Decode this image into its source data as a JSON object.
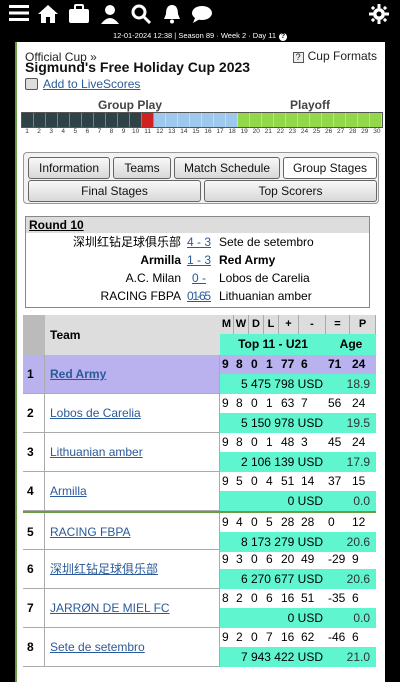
{
  "status": {
    "text": "12-01-2024 12:38 | Season 89 · Week 2 · Day 11",
    "help": "?"
  },
  "header": {
    "breadcrumb": "Official Cup »",
    "title": "Sigmund's Free Holiday Cup 2023",
    "cup_formats": "Cup Formats",
    "livescores": "Add to LiveScores"
  },
  "progress": {
    "group_label": "Group Play",
    "playoff_label": "Playoff",
    "days": [
      "1",
      "2",
      "3",
      "4",
      "5",
      "6",
      "7",
      "8",
      "9",
      "10",
      "11",
      "12",
      "13",
      "14",
      "15",
      "16",
      "17",
      "18",
      "19",
      "20",
      "21",
      "22",
      "23",
      "24",
      "25",
      "26",
      "27",
      "28",
      "29",
      "30"
    ],
    "current_day": 11,
    "colors": {
      "played": "#2f4248",
      "current": "#d02020",
      "group": "#9ec8ec",
      "playoff": "#92d84a"
    }
  },
  "tabs": {
    "information": "Information",
    "teams": "Teams",
    "schedule": "Match Schedule",
    "group_stages": "Group Stages",
    "final_stages": "Final Stages",
    "top_scorers": "Top Scorers"
  },
  "round": {
    "title": "Round 10",
    "matches": [
      {
        "home": "深圳红钻足球俱乐部",
        "score": "4 - 3",
        "away": "Sete de setembro",
        "bold": false
      },
      {
        "home": "Armilla",
        "score": "1 - 3",
        "away": "Red Army",
        "bold": true
      },
      {
        "home": "A.C. Milan",
        "score": "0 - 16",
        "away": "Lobos de Carelia",
        "bold": false
      },
      {
        "home": "RACING FBPA",
        "score": "0 - 5",
        "away": "Lithuanian amber",
        "bold": false
      }
    ]
  },
  "standings": {
    "col_team": "Team",
    "cols": [
      "M",
      "W",
      "D",
      "L",
      "+",
      "-",
      "=",
      "P"
    ],
    "sub_top": "Top 11 - U21",
    "sub_age": "Age",
    "rows": [
      {
        "pos": "1",
        "team": "Red Army",
        "m": "9",
        "w": "8",
        "d": "0",
        "l": "1",
        "gf": "77",
        "ga": "6",
        "diff": "71",
        "p": "24",
        "value": "5 475 798 USD",
        "age": "18.9"
      },
      {
        "pos": "2",
        "team": "Lobos de Carelia",
        "m": "9",
        "w": "8",
        "d": "0",
        "l": "1",
        "gf": "63",
        "ga": "7",
        "diff": "56",
        "p": "24",
        "value": "5 150 978 USD",
        "age": "19.5"
      },
      {
        "pos": "3",
        "team": "Lithuanian amber",
        "m": "9",
        "w": "8",
        "d": "0",
        "l": "1",
        "gf": "48",
        "ga": "3",
        "diff": "45",
        "p": "24",
        "value": "2 106 139 USD",
        "age": "17.9"
      },
      {
        "pos": "4",
        "team": "Armilla",
        "m": "9",
        "w": "5",
        "d": "0",
        "l": "4",
        "gf": "51",
        "ga": "14",
        "diff": "37",
        "p": "15",
        "value": "0 USD",
        "age": "0.0"
      },
      {
        "pos": "5",
        "team": "RACING FBPA",
        "m": "9",
        "w": "4",
        "d": "0",
        "l": "5",
        "gf": "28",
        "ga": "28",
        "diff": "0",
        "p": "12",
        "value": "8 173 279 USD",
        "age": "20.6"
      },
      {
        "pos": "6",
        "team": "深圳红钻足球俱乐部",
        "m": "9",
        "w": "3",
        "d": "0",
        "l": "6",
        "gf": "20",
        "ga": "49",
        "diff": "-29",
        "p": "9",
        "value": "6 270 677 USD",
        "age": "20.6"
      },
      {
        "pos": "7",
        "team": "JARRØN DE MIEL FC",
        "m": "8",
        "w": "2",
        "d": "0",
        "l": "6",
        "gf": "16",
        "ga": "51",
        "diff": "-35",
        "p": "6",
        "value": "0 USD",
        "age": "0.0"
      },
      {
        "pos": "8",
        "team": "Sete de setembro",
        "m": "9",
        "w": "2",
        "d": "0",
        "l": "7",
        "gf": "16",
        "ga": "62",
        "diff": "-46",
        "p": "6",
        "value": "7 943 422 USD",
        "age": "21.0"
      }
    ]
  },
  "colors": {
    "highlight_row": "#b9b2ee",
    "money_bg": "#5ff5cf",
    "accent_green": "#6a9b45",
    "link": "#2a5a9a"
  }
}
